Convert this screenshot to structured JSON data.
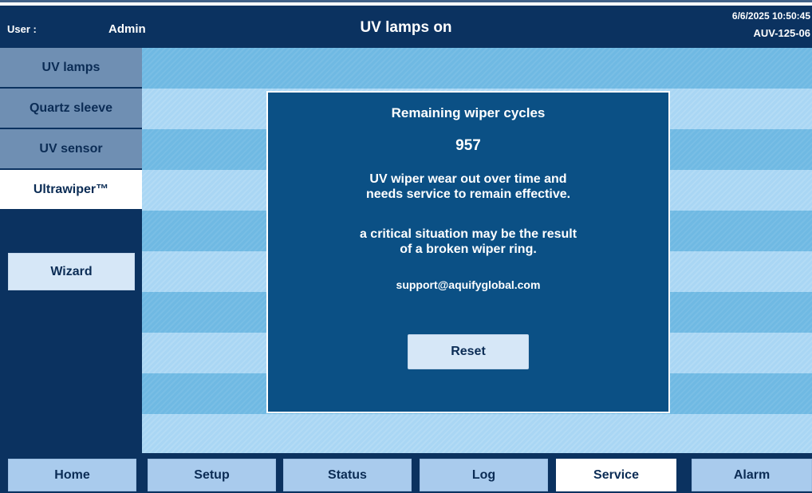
{
  "header": {
    "user_label": "User :",
    "user_name": "Admin",
    "title": "UV lamps on",
    "datetime": "6/6/2025 10:50:45",
    "device_id": "AUV-125-06"
  },
  "sidebar": {
    "items": [
      {
        "label": "UV lamps",
        "active": false
      },
      {
        "label": "Quartz sleeve",
        "active": false
      },
      {
        "label": "UV sensor",
        "active": false
      },
      {
        "label": "Ultrawiper™",
        "active": true
      }
    ],
    "wizard_label": "Wizard"
  },
  "dialog": {
    "title": "Remaining wiper cycles",
    "count": "957",
    "message1_line1": "UV wiper wear out over time and",
    "message1_line2": "needs service to remain effective.",
    "message2_line1": "a critical situation may be the result",
    "message2_line2": "of a broken wiper ring.",
    "email": "support@aquifyglobal.com",
    "reset_label": "Reset"
  },
  "bottom_nav": {
    "items": [
      {
        "label": "Home",
        "active": false
      },
      {
        "label": "Setup",
        "active": false
      },
      {
        "label": "Status",
        "active": false
      },
      {
        "label": "Log",
        "active": false
      },
      {
        "label": "Service",
        "active": true
      },
      {
        "label": "Alarm",
        "active": false
      }
    ]
  },
  "colors": {
    "navy": "#0b3260",
    "dialog": "#0b5085",
    "stripe_dark": "#6fb9e3",
    "stripe_light": "#a9d6f4",
    "button": "#a9cbed",
    "active": "#ffffff"
  }
}
